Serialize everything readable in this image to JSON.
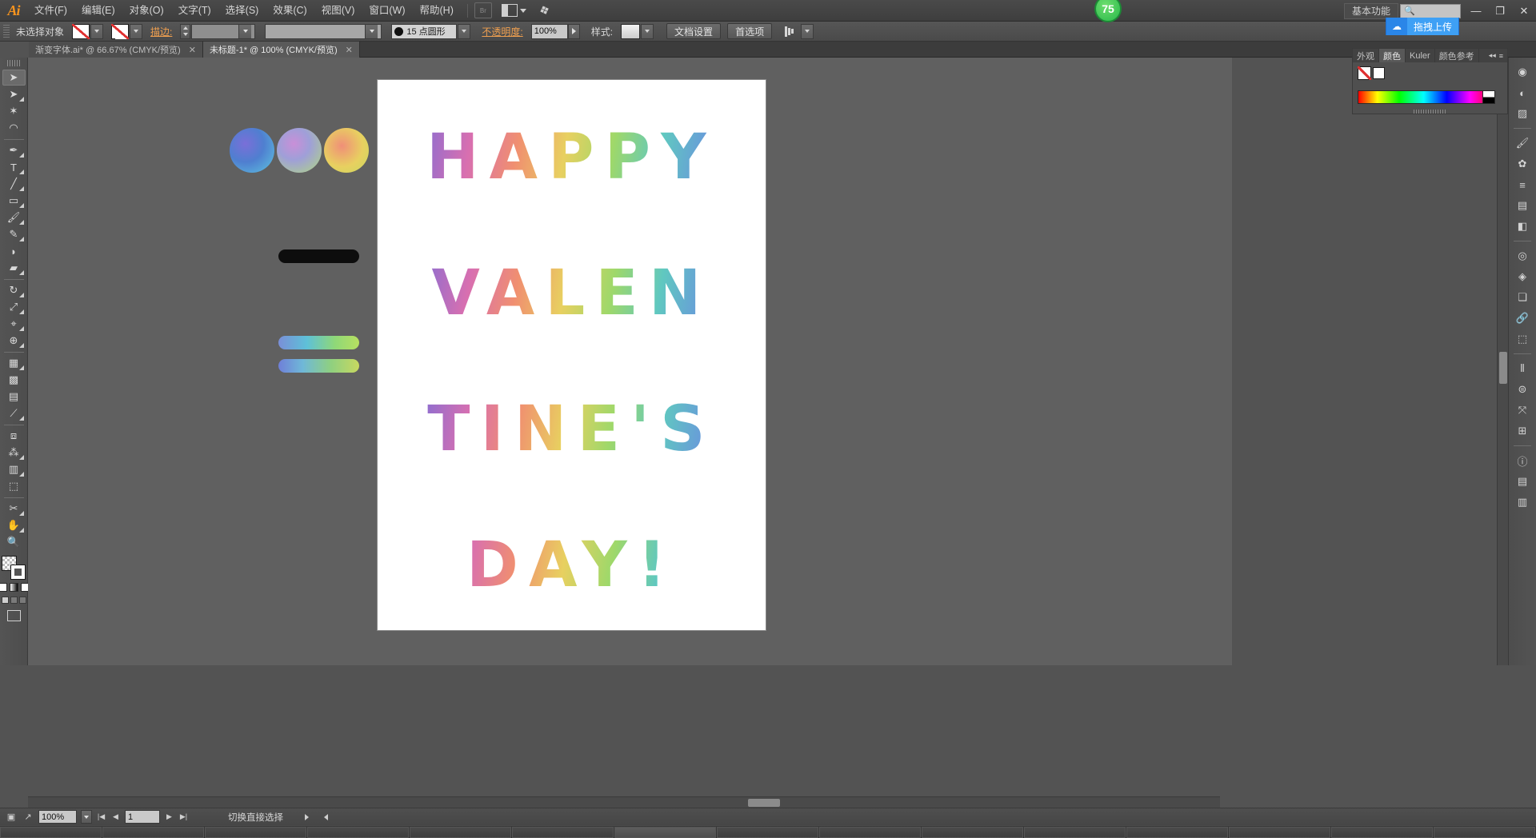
{
  "app": {
    "logo": "Ai",
    "title": "Adobe Illustrator"
  },
  "menu": {
    "items": [
      {
        "label": "文件(F)"
      },
      {
        "label": "编辑(E)"
      },
      {
        "label": "对象(O)"
      },
      {
        "label": "文字(T)"
      },
      {
        "label": "选择(S)"
      },
      {
        "label": "效果(C)"
      },
      {
        "label": "视图(V)"
      },
      {
        "label": "窗口(W)"
      },
      {
        "label": "帮助(H)"
      }
    ],
    "bridge_label": "Br",
    "workspace": "基本功能",
    "cc_badge": "75",
    "search_placeholder": "",
    "window_buttons": {
      "minimize": "—",
      "restore": "❐",
      "close": "✕"
    }
  },
  "upload": {
    "icon": "cloud-icon",
    "label": "拖拽上传"
  },
  "control": {
    "selection_status": "未选择对象",
    "fill_label": "",
    "stroke_label": "描边:",
    "stroke_weight": "",
    "stroke_profile": "",
    "brush_value": "15  点圆形",
    "opacity_label": "不透明度:",
    "opacity_value": "100%",
    "style_label": "样式:",
    "doc_setup": "文档设置",
    "preferences": "首选项",
    "align_label": ""
  },
  "tabs": [
    {
      "label": "渐变字体.ai* @ 66.67% (CMYK/预览)",
      "close": "✕",
      "active": false
    },
    {
      "label": "未标题-1* @ 100% (CMYK/预览)",
      "close": "✕",
      "active": true
    }
  ],
  "toolbar": {
    "tools": [
      {
        "name": "selection-tool",
        "glyph": "➤",
        "selected": true,
        "corner": false
      },
      {
        "name": "direct-selection-tool",
        "glyph": "➤",
        "selected": false,
        "corner": true
      },
      {
        "name": "magic-wand-tool",
        "glyph": "✶",
        "selected": false,
        "corner": false
      },
      {
        "name": "lasso-tool",
        "glyph": "◠",
        "selected": false,
        "corner": false
      },
      {
        "name": "pen-tool",
        "glyph": "✒",
        "selected": false,
        "corner": true
      },
      {
        "name": "type-tool",
        "glyph": "T",
        "selected": false,
        "corner": true
      },
      {
        "name": "line-segment-tool",
        "glyph": "╱",
        "selected": false,
        "corner": true
      },
      {
        "name": "rectangle-tool",
        "glyph": "▭",
        "selected": false,
        "corner": true
      },
      {
        "name": "paintbrush-tool",
        "glyph": "🖌",
        "selected": false,
        "corner": true
      },
      {
        "name": "pencil-tool",
        "glyph": "✎",
        "selected": false,
        "corner": true
      },
      {
        "name": "blob-brush-tool",
        "glyph": "◗",
        "selected": false,
        "corner": false
      },
      {
        "name": "eraser-tool",
        "glyph": "▰",
        "selected": false,
        "corner": true
      },
      {
        "name": "rotate-tool",
        "glyph": "↻",
        "selected": false,
        "corner": true
      },
      {
        "name": "scale-tool",
        "glyph": "⤢",
        "selected": false,
        "corner": true
      },
      {
        "name": "width-tool",
        "glyph": "⌖",
        "selected": false,
        "corner": true
      },
      {
        "name": "shape-builder-tool",
        "glyph": "⊕",
        "selected": false,
        "corner": true
      },
      {
        "name": "perspective-grid-tool",
        "glyph": "▦",
        "selected": false,
        "corner": true
      },
      {
        "name": "mesh-tool",
        "glyph": "▩",
        "selected": false,
        "corner": false
      },
      {
        "name": "gradient-tool",
        "glyph": "▤",
        "selected": false,
        "corner": false
      },
      {
        "name": "eyedropper-tool",
        "glyph": "⟋",
        "selected": false,
        "corner": true
      },
      {
        "name": "blend-tool",
        "glyph": "⧈",
        "selected": false,
        "corner": false
      },
      {
        "name": "symbol-sprayer-tool",
        "glyph": "⁂",
        "selected": false,
        "corner": true
      },
      {
        "name": "column-graph-tool",
        "glyph": "▥",
        "selected": false,
        "corner": true
      },
      {
        "name": "artboard-tool",
        "glyph": "⬚",
        "selected": false,
        "corner": false
      },
      {
        "name": "slice-tool",
        "glyph": "✂",
        "selected": false,
        "corner": true
      },
      {
        "name": "hand-tool",
        "glyph": "✋",
        "selected": false,
        "corner": true
      },
      {
        "name": "zoom-tool",
        "glyph": "🔍",
        "selected": false,
        "corner": false
      }
    ]
  },
  "dock": {
    "buttons": [
      {
        "name": "panel-color-icon",
        "glyph": "◉"
      },
      {
        "name": "panel-color-guide-icon",
        "glyph": "◐"
      },
      {
        "name": "panel-swatches-icon",
        "glyph": "▨"
      },
      {
        "name": "panel-brushes-icon",
        "glyph": "🖌"
      },
      {
        "name": "panel-symbols-icon",
        "glyph": "✿"
      },
      {
        "name": "panel-stroke-icon",
        "glyph": "≡"
      },
      {
        "name": "panel-gradient-icon",
        "glyph": "▤"
      },
      {
        "name": "panel-transparency-icon",
        "glyph": "◧"
      },
      {
        "name": "panel-appearance-icon",
        "glyph": "◎"
      },
      {
        "name": "panel-graphic-styles-icon",
        "glyph": "◈"
      },
      {
        "name": "panel-layers-icon",
        "glyph": "❏"
      },
      {
        "name": "panel-links-icon",
        "glyph": "🔗"
      },
      {
        "name": "panel-artboards-icon",
        "glyph": "⬚"
      },
      {
        "name": "panel-align-icon",
        "glyph": "⫴"
      },
      {
        "name": "panel-pathfinder-icon",
        "glyph": "⊜"
      },
      {
        "name": "panel-transform-icon",
        "glyph": "⤧"
      },
      {
        "name": "panel-navigator-icon",
        "glyph": "⊞"
      },
      {
        "name": "panel-info-icon",
        "glyph": "ⓘ"
      },
      {
        "name": "panel-document-info-icon",
        "glyph": "▤"
      },
      {
        "name": "panel-separate-icon",
        "glyph": "▥"
      }
    ]
  },
  "color_panel": {
    "tabs": [
      {
        "label": "外观",
        "active": false
      },
      {
        "label": "颜色",
        "active": true
      },
      {
        "label": "Kuler",
        "active": false
      },
      {
        "label": "颜色参考",
        "active": false
      }
    ],
    "menu_glyph": "≡",
    "close_glyph": "◂◂",
    "swatch_none": "none-swatch",
    "swatch_white": "#ffffff"
  },
  "artwork": {
    "lines": [
      "HAPPY",
      "VALEN",
      "TINE'S",
      "DAY!"
    ],
    "gradient_stops": [
      "#5a6fd0",
      "#8e6ed0",
      "#d86fb0",
      "#f08f70",
      "#e8d060",
      "#9ed86a",
      "#60c8c0",
      "#6a8fe0"
    ],
    "objects": [
      {
        "name": "gradient-circle-1"
      },
      {
        "name": "gradient-circle-2"
      },
      {
        "name": "gradient-circle-3"
      },
      {
        "name": "black-rounded-bar"
      },
      {
        "name": "gradient-rounded-bar-1"
      },
      {
        "name": "gradient-rounded-bar-2"
      }
    ]
  },
  "status": {
    "artboard_icon": "artboard-nav-icon",
    "export_icon": "export-icon",
    "zoom_value": "100%",
    "page_value": "1",
    "tool_hint": "切换直接选择",
    "first_glyph": "|◀",
    "prev_glyph": "◀",
    "next_glyph": "▶",
    "last_glyph": "▶|"
  },
  "taskbar": {
    "items": [
      {
        "label": ""
      },
      {
        "label": ""
      },
      {
        "label": ""
      },
      {
        "label": ""
      },
      {
        "label": ""
      },
      {
        "label": ""
      },
      {
        "label": ""
      },
      {
        "label": ""
      },
      {
        "label": ""
      },
      {
        "label": ""
      },
      {
        "label": ""
      },
      {
        "label": ""
      },
      {
        "label": ""
      },
      {
        "label": ""
      },
      {
        "label": ""
      }
    ]
  }
}
